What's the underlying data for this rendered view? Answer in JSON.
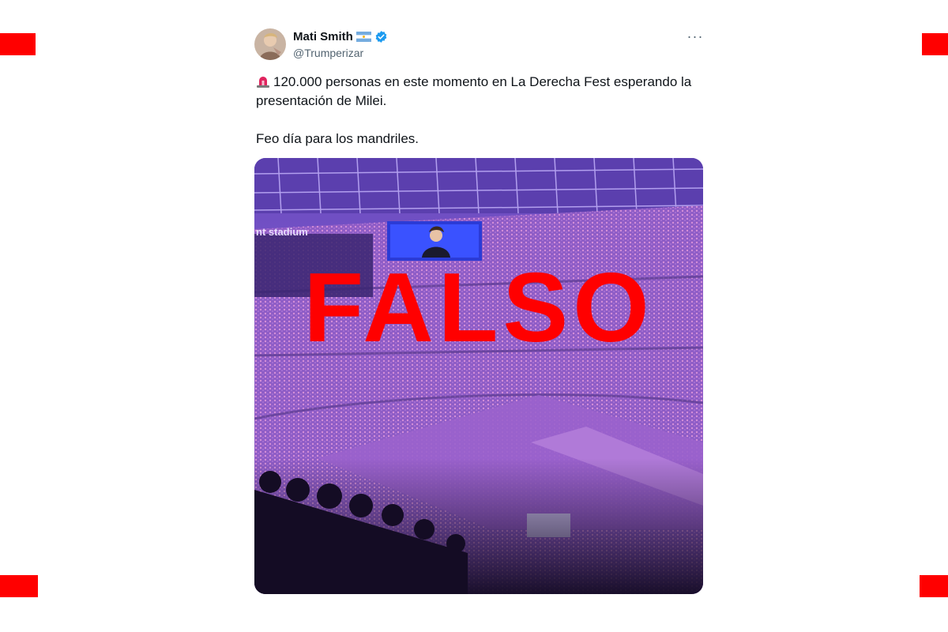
{
  "tweet": {
    "author": {
      "name": "Mati Smith",
      "handle": "@Trumperizar",
      "flag": "argentina-flag-icon",
      "verified": true,
      "verified_color": "#1d9bf0"
    },
    "more_menu_label": "···",
    "text_lines": [
      "120.000 personas en este momento en La Derecha Fest esperando la presentación de Milei.",
      "Feo día para los mandriles."
    ],
    "leading_emoji": "police-light-icon",
    "media": {
      "venue_sign": "nt stadium",
      "stamp": "FALSO",
      "stamp_color": "#ff0000"
    }
  },
  "decor": {
    "corner_mark_color": "#ff0000"
  }
}
